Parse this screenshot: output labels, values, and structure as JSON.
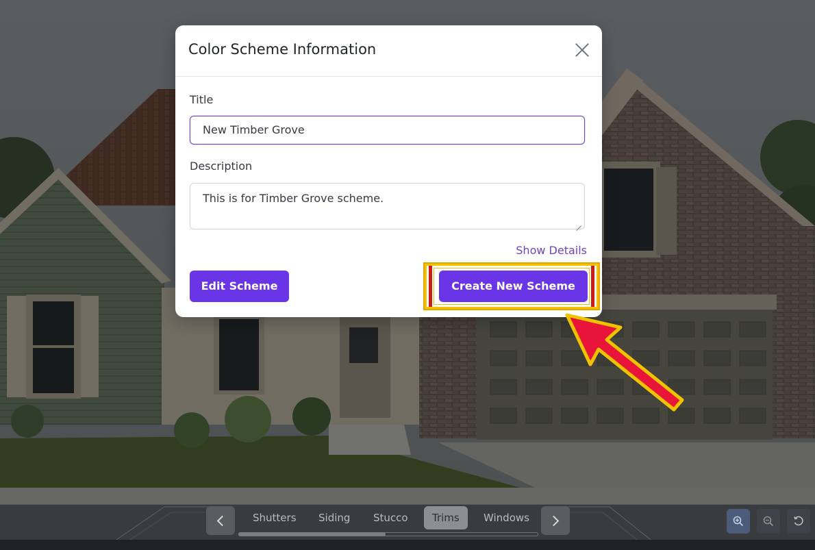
{
  "modal": {
    "title": "Color Scheme Information",
    "title_label": "Title",
    "title_value": "New Timber Grove",
    "description_label": "Description",
    "description_value": "This is for Timber Grove scheme.",
    "show_details": "Show Details",
    "edit_button": "Edit Scheme",
    "create_button": "Create New Scheme"
  },
  "toolbar": {
    "tabs": [
      {
        "label": "Shutters",
        "active": false
      },
      {
        "label": "Siding",
        "active": false
      },
      {
        "label": "Stucco",
        "active": false
      },
      {
        "label": "Trims",
        "active": true
      },
      {
        "label": "Windows",
        "active": false
      }
    ],
    "scroll_position": 0.49
  },
  "colors": {
    "accent": "#6a35e6",
    "focus_border": "#6f42c1",
    "highlight_yellow": "#f3c300",
    "highlight_red": "#cc1b1b",
    "arrow_fill": "#e8143a"
  },
  "icons": {
    "close": "close-icon",
    "prev": "chevron-left-icon",
    "next": "chevron-right-icon",
    "zoom_in": "zoom-in-icon",
    "zoom_out": "zoom-out-icon",
    "reset": "reset-icon",
    "pointer": "arrow-pointer-icon"
  }
}
